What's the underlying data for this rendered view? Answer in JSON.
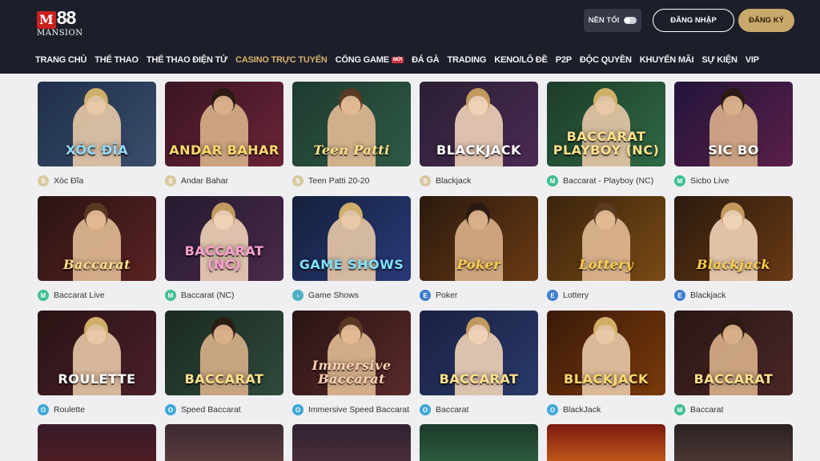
{
  "header": {
    "logo_num": "88",
    "logo_m": "M",
    "logo_sub": "MANSION",
    "theme_label": "NỀN TỐI",
    "login_label": "ĐĂNG NHẬP",
    "register_label": "ĐĂNG KÝ",
    "colors": {
      "bg": "#1c1f2a",
      "accent": "#c9a86b",
      "active_nav": "#d9b26a"
    }
  },
  "nav": {
    "items": [
      {
        "label": "TRANG CHỦ"
      },
      {
        "label": "THỂ THAO"
      },
      {
        "label": "THỂ THAO ĐIỆN TỬ"
      },
      {
        "label": "CASINO TRỰC TUYẾN",
        "active": true
      },
      {
        "label": "CỔNG GAME",
        "badge": "MỚI"
      },
      {
        "label": "ĐÁ GÀ"
      },
      {
        "label": "TRADING"
      },
      {
        "label": "KENO/LÔ ĐỀ"
      },
      {
        "label": "P2P"
      },
      {
        "label": "ĐỘC QUYỀN"
      },
      {
        "label": "KHUYẾN MÃI"
      },
      {
        "label": "SỰ KIỆN"
      },
      {
        "label": "VIP"
      }
    ]
  },
  "games": [
    {
      "name": "Xóc Đĩa",
      "banner": "XÓC ĐĨA",
      "provider_icon": "sa-icon"
    },
    {
      "name": "Andar Bahar",
      "banner": "ANDAR BAHAR",
      "provider_icon": "sa-icon"
    },
    {
      "name": "Teen Patti 20-20",
      "banner": "Teen Patti",
      "provider_icon": "sa-icon"
    },
    {
      "name": "Blackjack",
      "banner": "BLACKJACK",
      "provider_icon": "sa-icon"
    },
    {
      "name": "Baccarat - Playboy (NC)",
      "banner": "BACCARAT PLAYBOY (NC)",
      "provider_icon": "m-icon"
    },
    {
      "name": "Sicbo Live",
      "banner": "SIC BO",
      "provider_icon": "m-icon"
    },
    {
      "name": "Baccarat Live",
      "banner": "Baccarat",
      "provider_icon": "m-icon"
    },
    {
      "name": "Baccarat (NC)",
      "banner": "BACCARAT (NC)",
      "provider_icon": "m-icon"
    },
    {
      "name": "Game Shows",
      "banner": "GAME SHOWS",
      "provider_icon": "arrow-icon"
    },
    {
      "name": "Poker",
      "banner": "Poker",
      "provider_icon": "e-icon"
    },
    {
      "name": "Lottery",
      "banner": "Lottery",
      "provider_icon": "e-icon"
    },
    {
      "name": "Blackjack",
      "banner": "Blackjack",
      "provider_icon": "e-icon"
    },
    {
      "name": "Roulette",
      "banner": "ROULETTE",
      "provider_icon": "o-icon"
    },
    {
      "name": "Speed Baccarat",
      "banner": "BACCARAT",
      "provider_icon": "o-icon"
    },
    {
      "name": "Immersive Speed Baccarat",
      "banner": "Immersive Baccarat",
      "provider_icon": "o-icon"
    },
    {
      "name": "Baccarat",
      "banner": "BACCARAT",
      "provider_icon": "o-icon"
    },
    {
      "name": "BlackJack",
      "banner": "BLACKJACK",
      "provider_icon": "o-icon"
    },
    {
      "name": "Baccarat",
      "banner": "BACCARAT",
      "provider_icon": "m-icon"
    }
  ]
}
